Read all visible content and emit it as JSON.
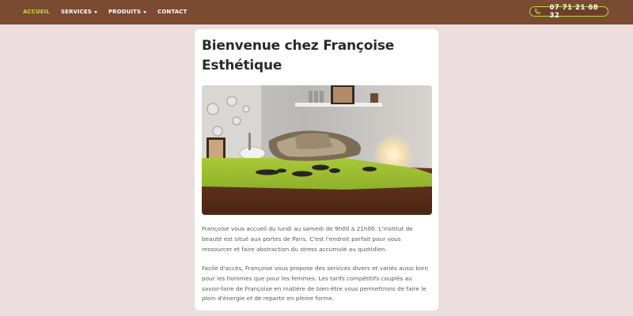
{
  "nav": {
    "items": [
      {
        "label": "ACCUEIL",
        "active": true,
        "has_dropdown": false
      },
      {
        "label": "SERVICES",
        "active": false,
        "has_dropdown": true
      },
      {
        "label": "PRODUITS",
        "active": false,
        "has_dropdown": true
      },
      {
        "label": "CONTACT",
        "active": false,
        "has_dropdown": false
      }
    ]
  },
  "phone": {
    "icon": "phone-icon",
    "number": "07 71 21 68 32"
  },
  "main": {
    "title": "Bienvenue chez Françoise Esthétique",
    "hero_image": "spa-massage-table-photo",
    "paragraphs": [
      "Françoise vous accueil du lundi au samedi de 9h00 à 21h00. L'institut de beauté est situé aux portes de Paris. C'est l'endroit parfait pour vous ressourcer et faire abstraction du stress accumulé au quotidien.",
      "Facile d'accès, Françoise vous propose des services divers et variés aussi bien pour les hommes que pour les femmes. Les tarifs compétitifs couplés au savoir-faire de Françoise en matière de bien-être vous permettrons de faire le plein d'énergie et de repartir en pleine forme."
    ]
  },
  "colors": {
    "header_bg": "#7a4a31",
    "accent": "#c2dc3b",
    "page_bg": "#ecdede"
  }
}
